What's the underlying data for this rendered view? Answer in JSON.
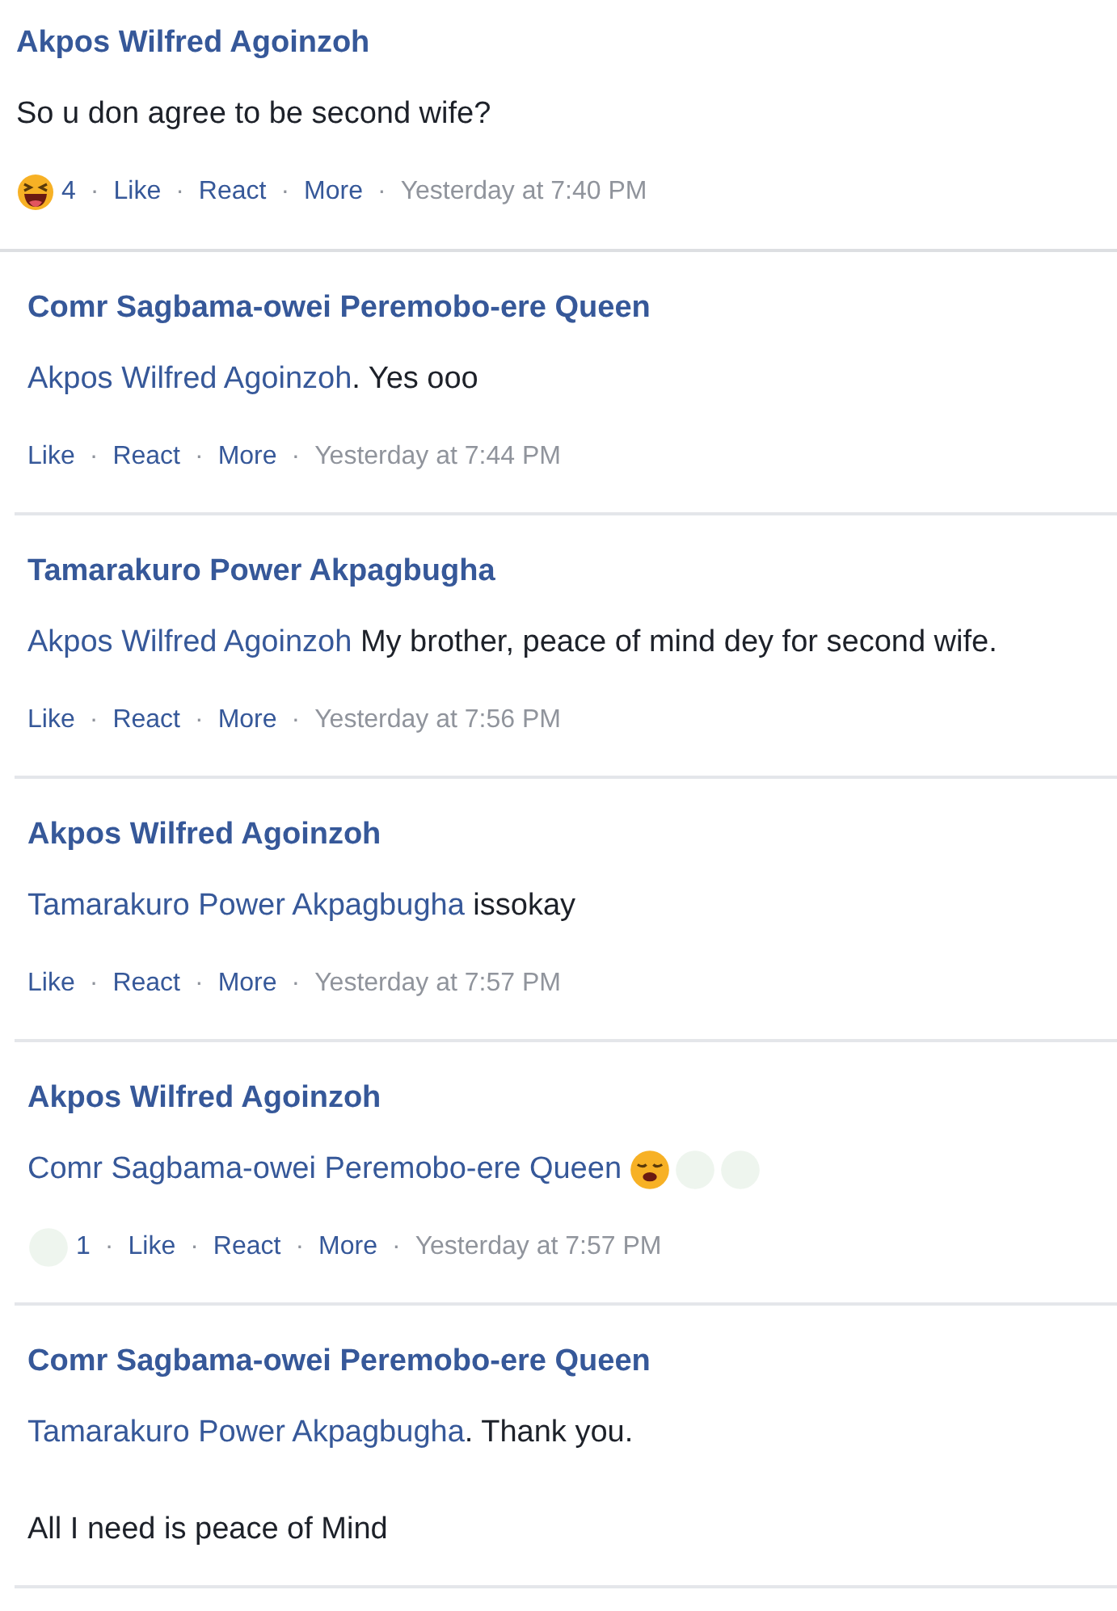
{
  "separator": "·",
  "comments": [
    {
      "kind": "top",
      "author": "Akpos Wilfred Agoinzoh",
      "text": "So u don agree to be second wife?",
      "reaction": {
        "kind": "laugh",
        "count": "4"
      },
      "actions": [
        "Like",
        "React",
        "More"
      ],
      "time": "Yesterday at 7:40 PM"
    },
    {
      "kind": "reply",
      "author": "Comr Sagbama-owei Peremobo-ere Queen",
      "mention": "Akpos Wilfred Agoinzoh",
      "text": ". Yes ooo",
      "actions": [
        "Like",
        "React",
        "More"
      ],
      "time": "Yesterday at 7:44 PM"
    },
    {
      "kind": "reply",
      "author": "Tamarakuro Power Akpagbugha",
      "mention": "Akpos Wilfred Agoinzoh",
      "text": " My brother, peace of mind dey for second wife.",
      "actions": [
        "Like",
        "React",
        "More"
      ],
      "time": "Yesterday at 7:56 PM"
    },
    {
      "kind": "reply",
      "author": "Akpos Wilfred Agoinzoh",
      "mention": "Tamarakuro Power Akpagbugha",
      "text": " issokay",
      "actions": [
        "Like",
        "React",
        "More"
      ],
      "time": "Yesterday at 7:57 PM"
    },
    {
      "kind": "reply",
      "author": "Akpos Wilfred Agoinzoh",
      "mention": "Comr Sagbama-owei Peremobo-ere Queen",
      "emojis": [
        {
          "kind": "tired"
        },
        {
          "kind": "faded"
        },
        {
          "kind": "faded"
        }
      ],
      "reaction": {
        "kind": "faded",
        "count": "1"
      },
      "actions": [
        "Like",
        "React",
        "More"
      ],
      "time": "Yesterday at 7:57 PM"
    },
    {
      "kind": "reply",
      "author": "Comr Sagbama-owei Peremobo-ere Queen",
      "mention": "Tamarakuro Power Akpagbugha",
      "text": ". Thank you.",
      "paragraphs": [
        "All I need is peace of Mind"
      ]
    }
  ]
}
